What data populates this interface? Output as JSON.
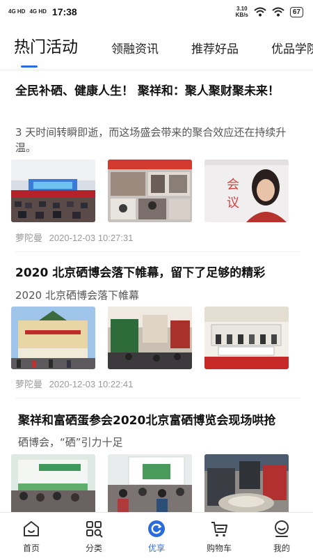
{
  "status_bar": {
    "network_left": "4G HD",
    "network_right": "4G HD",
    "time": "17:38",
    "speed_value": "3.10",
    "speed_unit": "KB/s",
    "battery": "67"
  },
  "tabs": [
    {
      "label": "热门活动",
      "active": true
    },
    {
      "label": "领融资讯",
      "active": false
    },
    {
      "label": "推荐好品",
      "active": false
    },
    {
      "label": "优品学院",
      "active": false
    }
  ],
  "accent_color": "#2b6cdc",
  "articles": [
    {
      "title": "全民补硒、健康人生！ 聚祥和：聚人聚财聚未来！",
      "summary": "3 天时间转瞬即逝，而这场盛会带来的聚合效应还在持续升温。",
      "author": "萝陀曼",
      "time": "2020-12-03 10:27:31"
    },
    {
      "title": "2020 北京硒博会落下帷幕，留下了足够的精彩",
      "summary": "2020 北京硒博会落下帷幕",
      "author": "萝陀曼",
      "time": "2020-12-03 10:22:41"
    },
    {
      "title": "聚祥和富硒蛋参会2020北京富硒博览会现场哄抢",
      "summary": "硒博会，“硒”引力十足",
      "author": "",
      "time": ""
    }
  ],
  "bottom_nav": [
    {
      "label": "首页",
      "icon": "home-icon"
    },
    {
      "label": "分类",
      "icon": "category-icon"
    },
    {
      "label": "优享",
      "icon": "youxiang-icon",
      "active": true
    },
    {
      "label": "购物车",
      "icon": "cart-icon"
    },
    {
      "label": "我的",
      "icon": "profile-icon"
    }
  ]
}
